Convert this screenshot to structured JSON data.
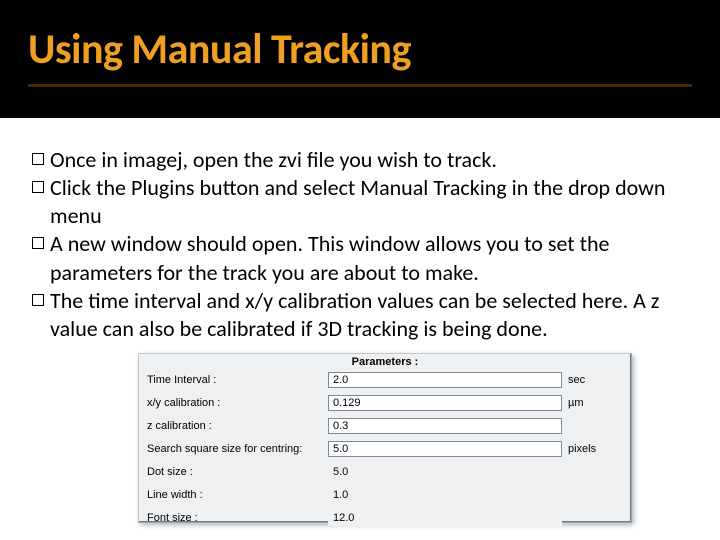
{
  "header": {
    "title": "Using Manual Tracking"
  },
  "bullets": {
    "b0": "Once in imagej, open the zvi file you wish to track.",
    "b1": "Click the Plugins button and select Manual Tracking in the drop down menu",
    "b2": "A new window should open. This window allows you to set the parameters for the track you are about to make.",
    "b3": "The time interval and x/y calibration values can be selected here. A z value can also be calibrated if 3D tracking is being done."
  },
  "panel": {
    "title": "Parameters :",
    "rows": {
      "time_interval": {
        "label": "Time Interval :",
        "value": "2.0",
        "unit": "sec"
      },
      "xy_calibration": {
        "label": "x/y calibration :",
        "value": "0.129",
        "unit": "µm"
      },
      "z_calibration": {
        "label": "z calibration :",
        "value": "0.3",
        "unit": ""
      },
      "search_square": {
        "label": "Search square size for centring:",
        "value": "5.0",
        "unit": "pixels"
      },
      "dot_size": {
        "label": "Dot size :",
        "value": "5.0",
        "unit": ""
      },
      "line_width": {
        "label": "Line width :",
        "value": "1.0",
        "unit": ""
      },
      "font_size": {
        "label": "Font size :",
        "value": "12.0",
        "unit": ""
      }
    }
  }
}
